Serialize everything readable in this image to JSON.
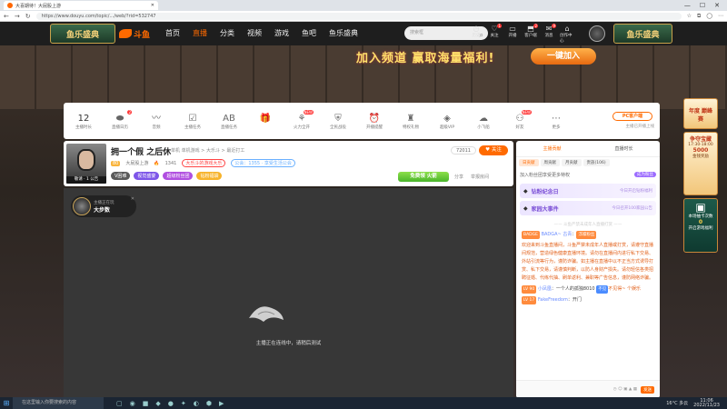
{
  "browser": {
    "tab_title": "大喜期待！大屁股上游",
    "url": "https://www.douyu.com/topic/.../web/?rid=532747",
    "back": "←",
    "forward": "→",
    "reload": "↻",
    "win_min": "—",
    "win_max": "☐",
    "win_close": "✕"
  },
  "header": {
    "event_logo": "鱼乐盛典",
    "brand": "斗鱼",
    "nav": [
      "首页",
      "直播",
      "分类",
      "视频",
      "游戏",
      "鱼吧",
      "鱼乐盛典"
    ],
    "search_placeholder": "搜索框",
    "icons": [
      {
        "label": "历史",
        "glyph": "◷",
        "name": "history-icon"
      },
      {
        "label": "关注",
        "glyph": "♡",
        "name": "follow-icon",
        "badge": "1"
      },
      {
        "label": "开播",
        "glyph": "▭",
        "name": "broadcast-icon"
      },
      {
        "label": "客户端",
        "glyph": "⬒",
        "name": "client-icon",
        "badge": "2"
      },
      {
        "label": "消息",
        "glyph": "✉",
        "name": "message-icon",
        "badge": "9"
      },
      {
        "label": "创作中心",
        "glyph": "⌂",
        "name": "creator-icon"
      }
    ]
  },
  "banner": {
    "text": "加入频道 赢取海量福利!",
    "button": "一键加入"
  },
  "toolbar": {
    "tools": [
      {
        "num": "12",
        "label": "主播时长",
        "name": "anchor-hours"
      },
      {
        "glyph": "⬬",
        "label": "直播日历",
        "name": "calendar-icon",
        "badge": "2"
      },
      {
        "glyph": "〰",
        "label": "音频",
        "name": "audio-icon"
      },
      {
        "glyph": "☑",
        "label": "主播任务",
        "name": "task-icon"
      },
      {
        "glyph": "AB",
        "label": "直播任务",
        "name": "ab-icon"
      },
      {
        "glyph": "🎁",
        "label": "",
        "name": "gift-icon"
      },
      {
        "glyph": "⚘",
        "label": "火力全开",
        "name": "fire-icon",
        "badge": "NEW"
      },
      {
        "glyph": "⛨",
        "label": "全民战役",
        "name": "shield-icon"
      },
      {
        "glyph": "⏰",
        "label": "开播提醒",
        "name": "alarm-icon"
      },
      {
        "glyph": "♜",
        "label": "特权礼物",
        "name": "privilege-icon"
      },
      {
        "glyph": "◈",
        "label": "超级VIP",
        "name": "vip-icon"
      },
      {
        "glyph": "☁",
        "label": "小飞船",
        "name": "ship-icon"
      },
      {
        "glyph": "⚇",
        "label": "好友",
        "name": "friends-icon",
        "badge": "NEW"
      },
      {
        "glyph": "⋯",
        "label": "更多",
        "name": "more-icon"
      }
    ],
    "pc_button": "PC客户端",
    "pc_sub": "主播已开播上线"
  },
  "room": {
    "title": "拥一个假 之后休",
    "meta": "单机  单机游戏 > 大乐斗 > 最近打工",
    "anchor_caption": "敬请 · 1 公告",
    "level": "80",
    "anchor_name": "大屁股上游",
    "hot": "1341",
    "pill1": "大乐斗的游戏大乐",
    "pill2": "公会：1355 · 享受生活公会",
    "tags": [
      {
        "text": "V困难",
        "color": "#5a5a5a"
      },
      {
        "text": "视觉盛宴",
        "color": "#7d55e8"
      },
      {
        "text": "超级粉丝团",
        "color": "#b04ee0"
      },
      {
        "text": "钻粉福袋",
        "color": "#f7b32b"
      }
    ],
    "viewers": "72011",
    "follow": "♥ 关注",
    "gift_banner": "免费领 火箭",
    "share": "分享",
    "report": "举报房间"
  },
  "video": {
    "chip_top": "主播正在玩",
    "chip_name": "大步数",
    "offline_text": "主播正在连线中，请稍后测试"
  },
  "chat": {
    "rank_tabs": [
      "主播贡献",
      "直播时长"
    ],
    "sub_tabs": [
      "日贡献",
      "周贡献",
      "月贡献",
      "贵族(106)"
    ],
    "rank_line": "加入粉丝团享受更多特权",
    "rank_button": "成为粉丝",
    "events": [
      {
        "title": "钻粉纪念日",
        "sub": "今日开启钻粉福利"
      },
      {
        "title": "家园大事件",
        "sub": "今日召开100家园公告"
      }
    ],
    "divider": "—— 斗鱼严禁未成年人直播打赏 ——",
    "messages": [
      {
        "type": "user",
        "badge": "BADGE",
        "name": "BADGA~ 古青",
        "text": "",
        "tag": "浮躁粉丝"
      },
      {
        "type": "sys",
        "text": "欢迎来到斗鱼直播间，斗鱼严禁未成年人直播或打赏，请遵守直播间规范，营造绿色健康直播环境。请勿在直播间内进行私下交易、外站引流等行为，谨防诈骗。如主播在直播中以不正当方式诱导打赏、私下交易，请谨慎判断，以防人身财产损失。请勿轻信各类招聘征婚、代练代抽、刷单返利、兼职等广告信息，谨防网络诈骗。"
      },
      {
        "type": "user",
        "badge": "LV 90",
        "name": "小凤凰",
        "text": "一个人的孤独8010",
        "tag2": "不见",
        "extra": "不见得~ 个娱乐"
      },
      {
        "type": "user",
        "badge": "LV 17",
        "name": "FakeFreedom",
        "text": "开门"
      }
    ],
    "send": "发送",
    "input_hint": "◷ ☺ ▣ ▲ ▦"
  },
  "side": {
    "b1": "年度 巅峰赛",
    "b2_title": "争夺宝藏",
    "b2_time": "17:30-18:00",
    "b2_value": "5000",
    "b2_sub": "金钱奖励",
    "b3": "本场抽卡次数",
    "b3_value": "0",
    "b3_sub": "开启游戏福利"
  },
  "taskbar": {
    "start": "⊞",
    "search": "在这里输入你要搜索的内容",
    "apps": [
      "▢",
      "◉",
      "■",
      "◆",
      "●",
      "✦",
      "◐",
      "⬢",
      "▶"
    ],
    "weather": "16°C 多云",
    "time": "11:06",
    "date": "2022/11/23"
  }
}
